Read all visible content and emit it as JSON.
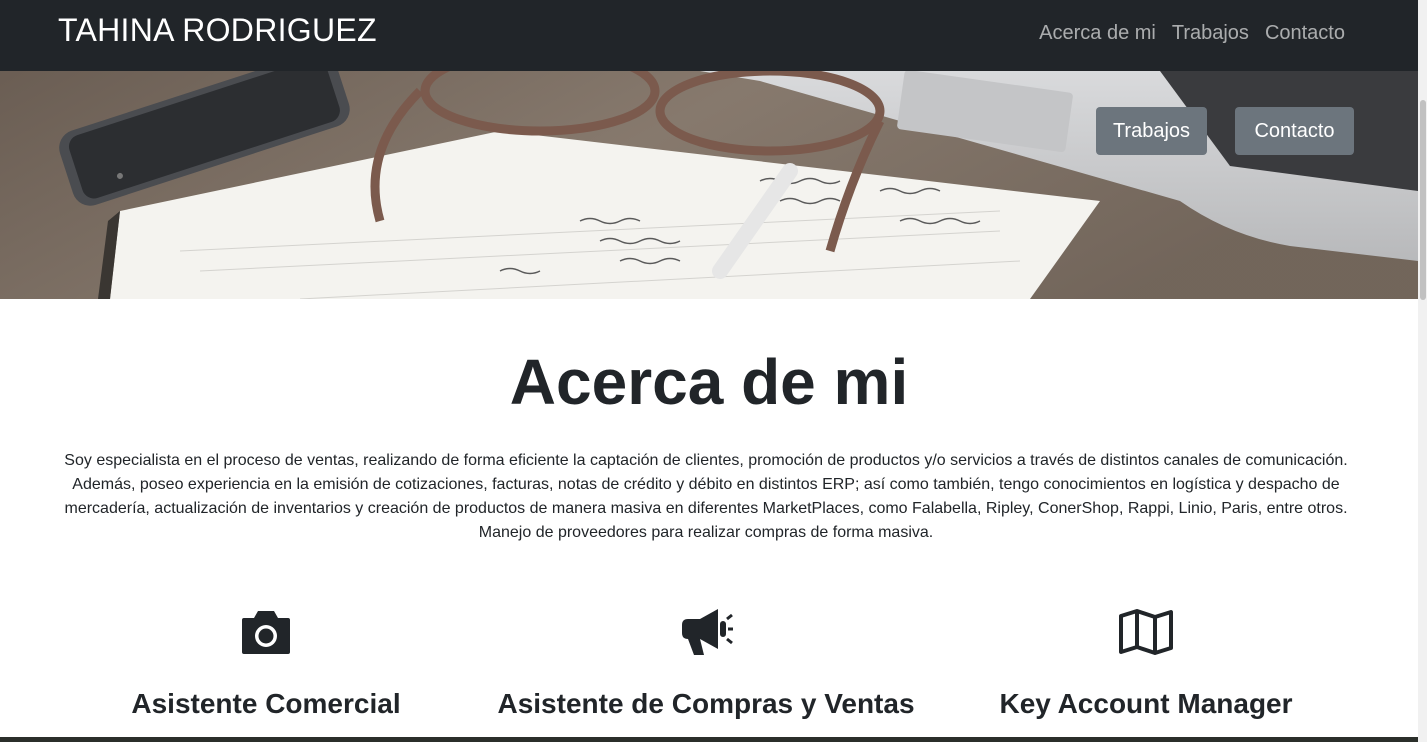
{
  "navbar": {
    "brand": "TAHINA RODRIGUEZ",
    "links": [
      "Acerca de mi",
      "Trabajos",
      "Contacto"
    ]
  },
  "hero": {
    "buttons": [
      "Trabajos",
      "Contacto"
    ]
  },
  "about": {
    "title": "Acerca de mi",
    "paragraph1": "Soy especialista en el proceso de ventas, realizando de forma eficiente la captación de clientes, promoción de productos y/o servicios a través de distintos canales de comunicación.",
    "paragraph2": "Además, poseo experiencia en la emisión de cotizaciones, facturas, notas de crédito y débito en distintos ERP; así como también, tengo conocimientos en logística y despacho de mercadería, actualización de inventarios y creación de productos de manera masiva en diferentes MarketPlaces, como Falabella, Ripley, ConerShop, Rappi, Linio, Paris, entre otros. Manejo de proveedores para realizar compras de forma masiva."
  },
  "services": [
    {
      "icon": "camera-icon",
      "title": "Asistente Comercial"
    },
    {
      "icon": "megaphone-icon",
      "title": "Asistente de Compras y Ventas"
    },
    {
      "icon": "map-icon",
      "title": "Key Account Manager"
    }
  ],
  "colors": {
    "navbar_bg": "#212529",
    "button_bg": "#6c757d",
    "text": "#212529"
  }
}
